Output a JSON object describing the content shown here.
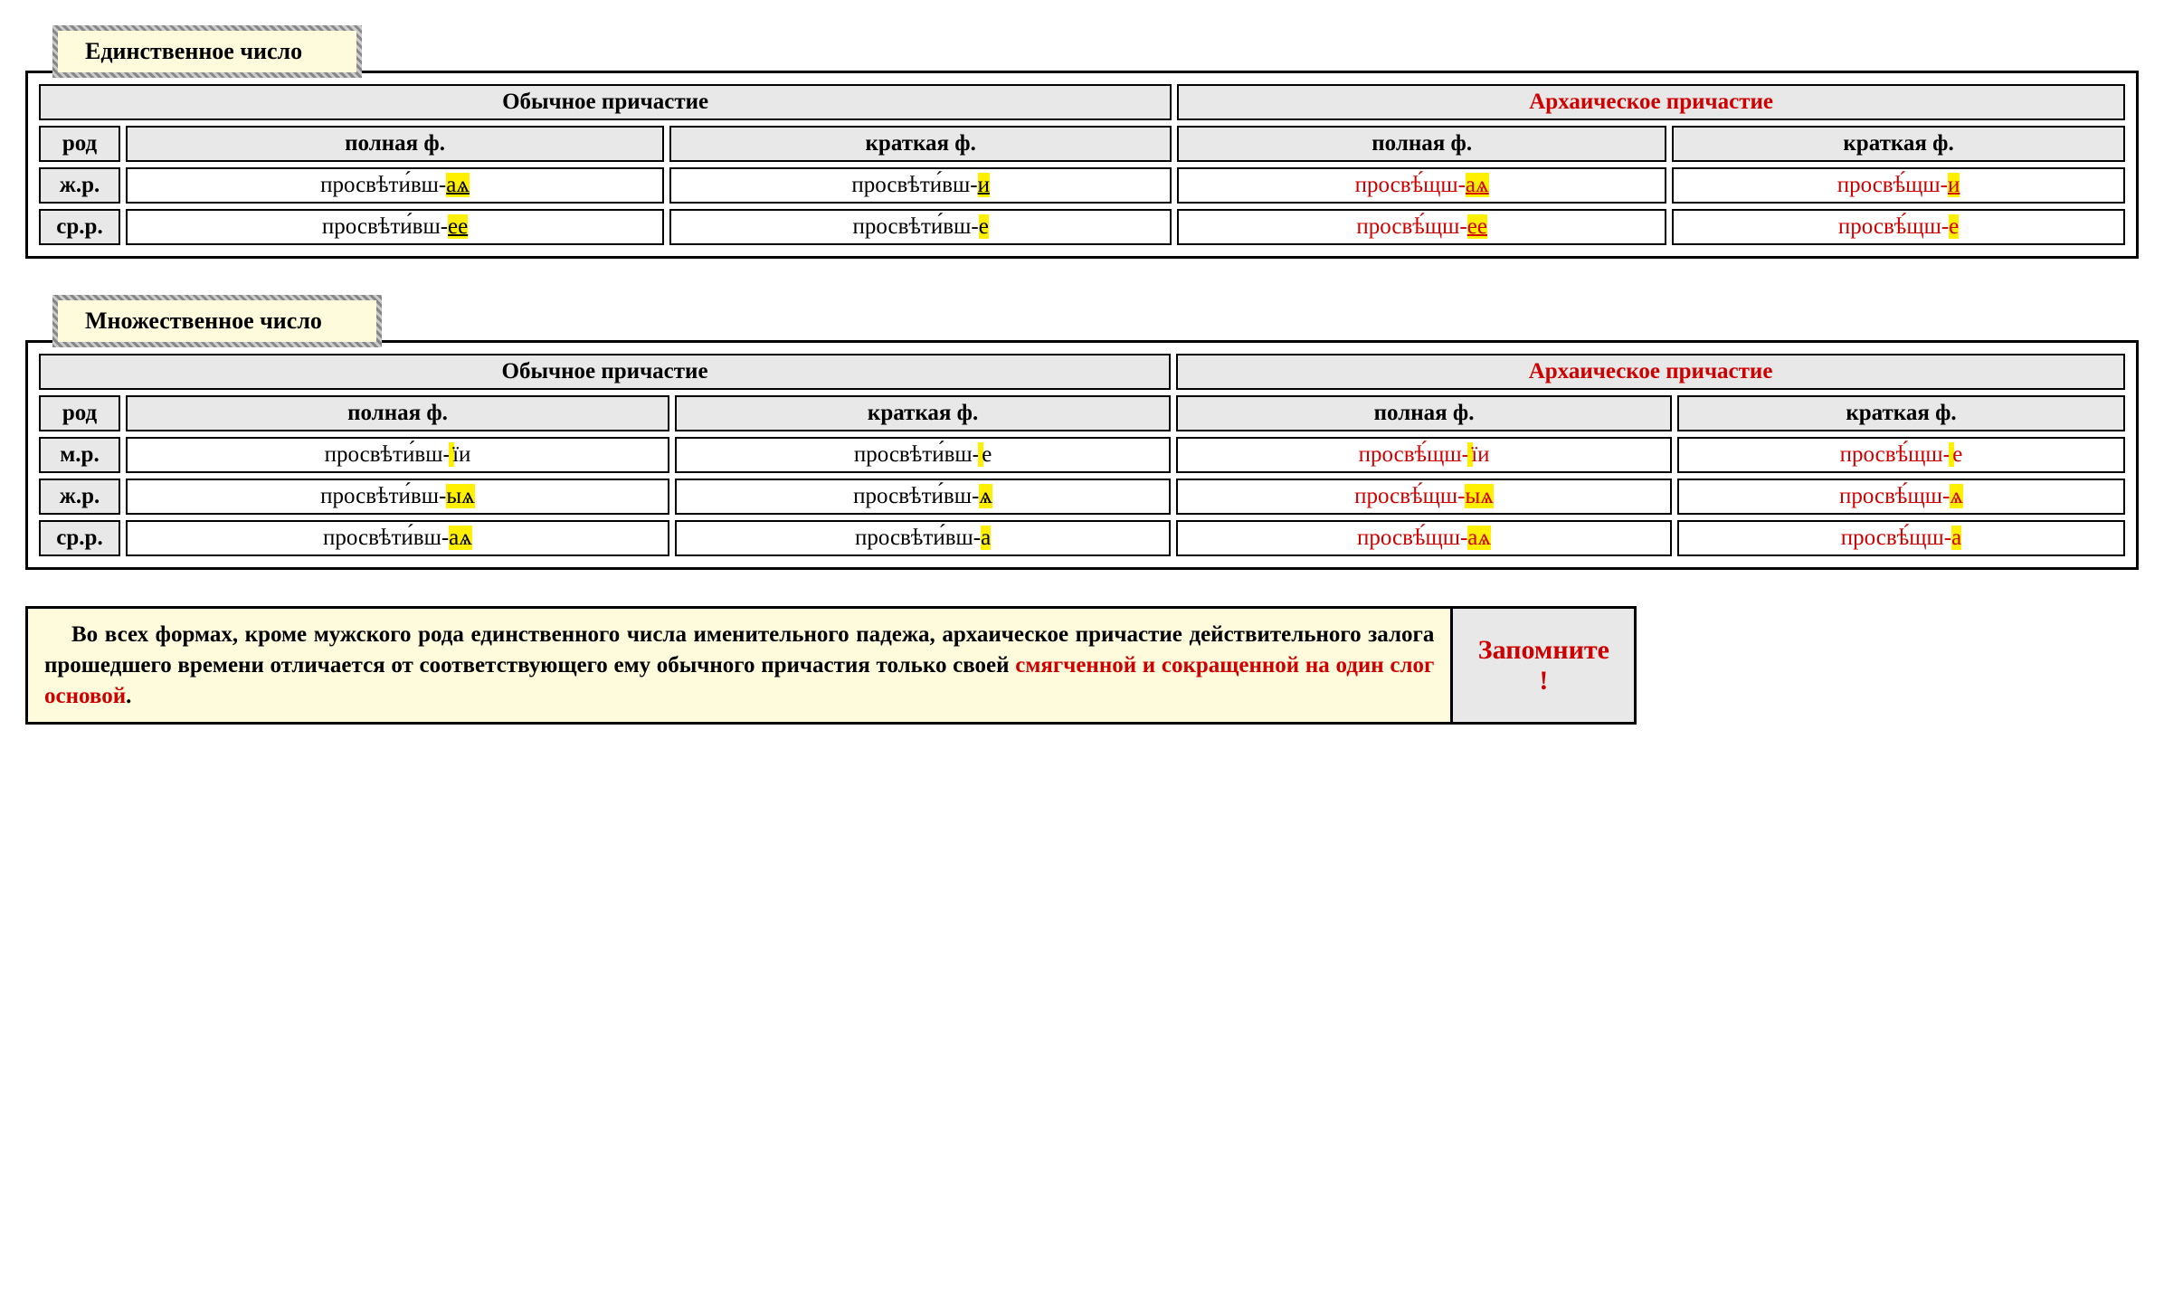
{
  "labels": {
    "singular": "Единственное число",
    "plural": "Множественное число",
    "ordinary": "Обычное причастие",
    "archaic": "Архаическое причастие",
    "gender": "род",
    "full": "полная ф.",
    "short": "краткая ф.",
    "gender_f": "ж.р.",
    "gender_n": "ср.р.",
    "gender_m": "м.р."
  },
  "singular": {
    "f": {
      "ord_full": {
        "stem": "просвѣти́вш-",
        "end": "аѧ",
        "underline": true
      },
      "ord_short": {
        "stem": "просвѣти́вш-",
        "end": "и",
        "underline": true
      },
      "arc_full": {
        "stem": "просвѣ́щш-",
        "end": "аѧ",
        "underline": true
      },
      "arc_short": {
        "stem": "просвѣ́щш-",
        "end": "и",
        "underline": true
      }
    },
    "n": {
      "ord_full": {
        "stem": "просвѣти́вш-",
        "end": "ее",
        "underline": true
      },
      "ord_short": {
        "stem": "просвѣти́вш-",
        "end": "е",
        "underline": false
      },
      "arc_full": {
        "stem": "просвѣ́щш-",
        "end": "ее",
        "underline": true
      },
      "arc_short": {
        "stem": "просвѣ́щш-",
        "end": "е",
        "underline": false
      }
    }
  },
  "plural": {
    "m": {
      "ord_full": {
        "stem": "просвѣти́вш-",
        "end": "їи",
        "underline": false,
        "prehl": true
      },
      "ord_short": {
        "stem": "просвѣти́вш-",
        "end": "е",
        "underline": false,
        "prehl": true
      },
      "arc_full": {
        "stem": "просвѣ́щш-",
        "end": "їи",
        "underline": false,
        "prehl": true
      },
      "arc_short": {
        "stem": "просвѣ́щш-",
        "end": "е",
        "underline": false,
        "prehl": true
      }
    },
    "f": {
      "ord_full": {
        "stem": "просвѣти́вш-",
        "end": "ыѧ",
        "underline": false
      },
      "ord_short": {
        "stem": "просвѣти́вш-",
        "end": "ѧ",
        "underline": false
      },
      "arc_full": {
        "stem": "просвѣ́щш-",
        "end": "ыѧ",
        "underline": false
      },
      "arc_short": {
        "stem": "просвѣ́щш-",
        "end": "ѧ",
        "underline": false
      }
    },
    "n": {
      "ord_full": {
        "stem": "просвѣти́вш-",
        "end": "аѧ",
        "underline": false
      },
      "ord_short": {
        "stem": "просвѣти́вш-",
        "end": "а",
        "underline": false
      },
      "arc_full": {
        "stem": "просвѣ́щш-",
        "end": "аѧ",
        "underline": false
      },
      "arc_short": {
        "stem": "просвѣ́щш-",
        "end": "а",
        "underline": false
      }
    }
  },
  "note": {
    "text_black": "Во всех формах, кроме мужского рода единственного числа именительного падежа, архаическое причастие действительного залога прошедшего времени отличается от соответствующего ему обычного причастия только своей ",
    "text_red": "смягченной и сокращенной на один слог основой",
    "period": ".",
    "label": "Запомните",
    "bang": "!"
  }
}
